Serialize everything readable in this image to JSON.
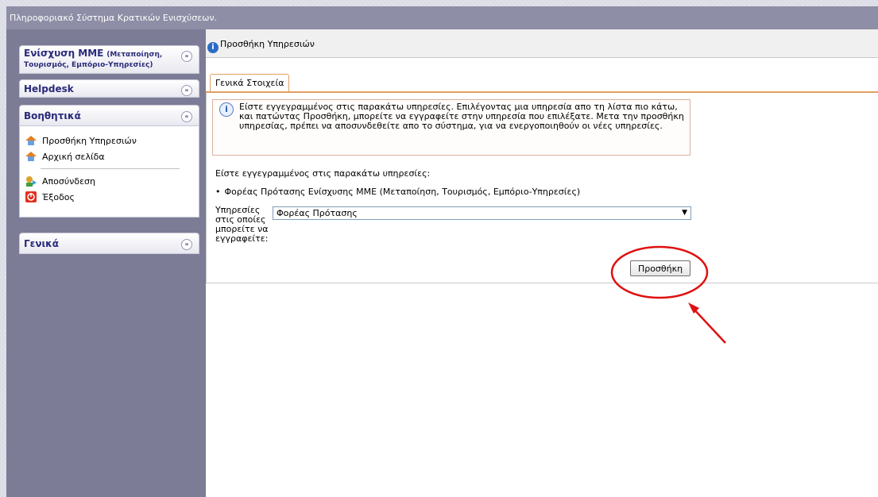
{
  "window": {
    "title": "Πληροφοριακό Σύστημα Κρατικών Ενισχύσεων."
  },
  "sidebar": {
    "panels": [
      {
        "title_main": "Ενίσχυση ΜΜΕ",
        "title_sub1": "(Μεταποίηση,",
        "title_sub2": "Τουρισμός, Εμπόριο-Υπηρεσίες)",
        "state": "collapsed"
      },
      {
        "title": "Helpdesk",
        "state": "collapsed"
      },
      {
        "title": "Βοηθητικά",
        "state": "expanded",
        "items": [
          "Προσθήκη Υπηρεσιών",
          "Αρχική σελίδα",
          "Αποσύνδεση",
          "Έξοδος"
        ]
      },
      {
        "title": "Γενικά",
        "state": "collapsed"
      }
    ]
  },
  "main": {
    "title": "Προσθήκη Υπηρεσιών",
    "tabs": [
      "Γενικά Στοιχεία"
    ],
    "notice": "Είστε εγγεγραμμένος στις παρακάτω υπηρεσίες. Επιλέγοντας μια υπηρεσία απο τη λίστα πιο κάτω, και πατώντας Προσθήκη, μπορείτε να εγγραφείτε στην υπηρεσία που επιλέξατε. Μετα την προσθήκη υπηρεσίας, πρέπει να αποσυνδεθείτε απο το σύστημα, για να ενεργοποιηθούν οι νέες υπηρεσίες.",
    "registered_heading": "Είστε εγγεγραμμένος στις παρακάτω υπηρεσίες:",
    "registered_services": [
      "Φορέας Πρότασης Ενίσχυσης ΜΜΕ (Μεταποίηση, Τουρισμός, Εμπόριο-Υπηρεσίες)"
    ],
    "field_label": "Υπηρεσίες στις οποίες μπορείτε να εγγραφείτε:",
    "select_value": "Φορέας Πρότασης",
    "add_button": "Προσθήκη"
  },
  "colors": {
    "titlebar": "#8e8ea6",
    "sidebar": "#7c7c96",
    "annotation": "#e01010",
    "tab_accent": "#e0a060"
  },
  "icons": {
    "chevron_down": "double-chevron-down-icon",
    "chevron_up": "double-chevron-up-icon",
    "info": "info-icon"
  }
}
